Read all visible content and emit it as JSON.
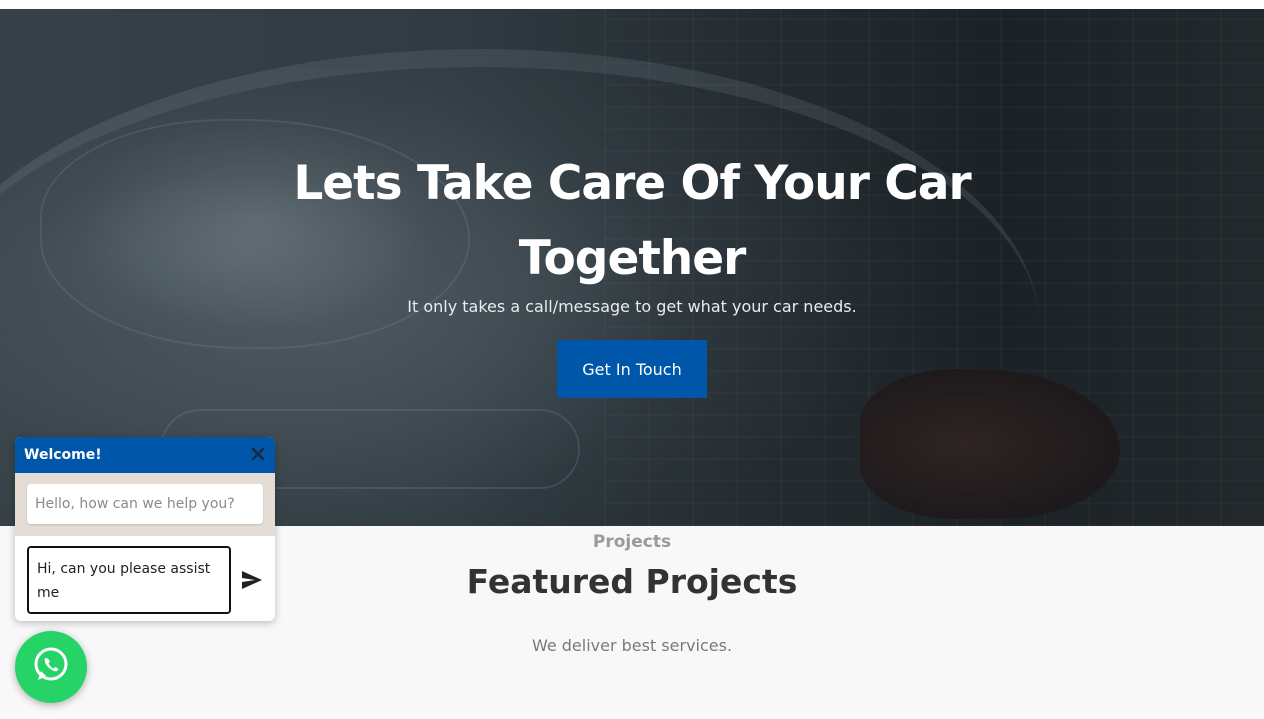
{
  "hero": {
    "title": "Lets Take Care Of Your Car Together",
    "subtitle": "It only takes a call/message to get what your car needs.",
    "cta_label": "Get In Touch"
  },
  "projects": {
    "label": "Projects",
    "title": "Featured Projects",
    "subtitle": "We deliver best services."
  },
  "chat": {
    "header_title": "Welcome!",
    "greeting": "Hello, how can we help you?",
    "input_value": "Hi, can you please assist me"
  },
  "icons": {
    "close": "close-icon",
    "send": "send-icon",
    "whatsapp": "whatsapp-icon"
  },
  "colors": {
    "brand_blue": "#0056a8",
    "whatsapp_green": "#25d366",
    "chat_body_bg": "#e4ddd6"
  }
}
